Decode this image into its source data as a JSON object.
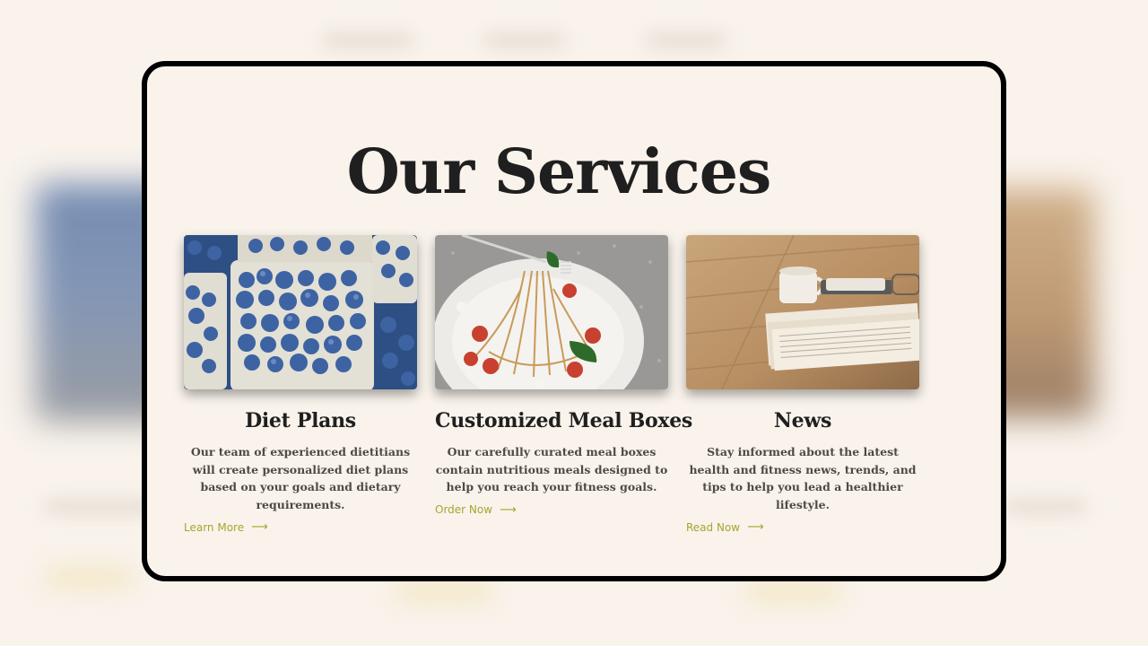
{
  "page": {
    "title": "Our Services"
  },
  "services": [
    {
      "title": "Diet Plans",
      "description": "Our team of experienced dietitians will create personalized diet plans based on your goals and dietary requirements.",
      "link_label": "Learn More",
      "image": "blueberries-photo"
    },
    {
      "title": "Customized Meal Boxes",
      "description": "Our carefully curated meal boxes contain nutritious meals designed to help you reach your fitness goals.",
      "link_label": "Order Now",
      "image": "spaghetti-photo"
    },
    {
      "title": "News",
      "description": "Stay informed about the latest health and fitness news, trends, and tips to help you lead a healthier lifestyle.",
      "link_label": "Read Now",
      "image": "newspaper-coffee-photo"
    }
  ],
  "colors": {
    "background": "#f9f3ec",
    "title": "#1f1f1f",
    "body_text": "#4d4a45",
    "link": "#a7a52d",
    "modal_border": "#000000"
  },
  "icons": {
    "link_arrow": "arrow-right-icon"
  }
}
